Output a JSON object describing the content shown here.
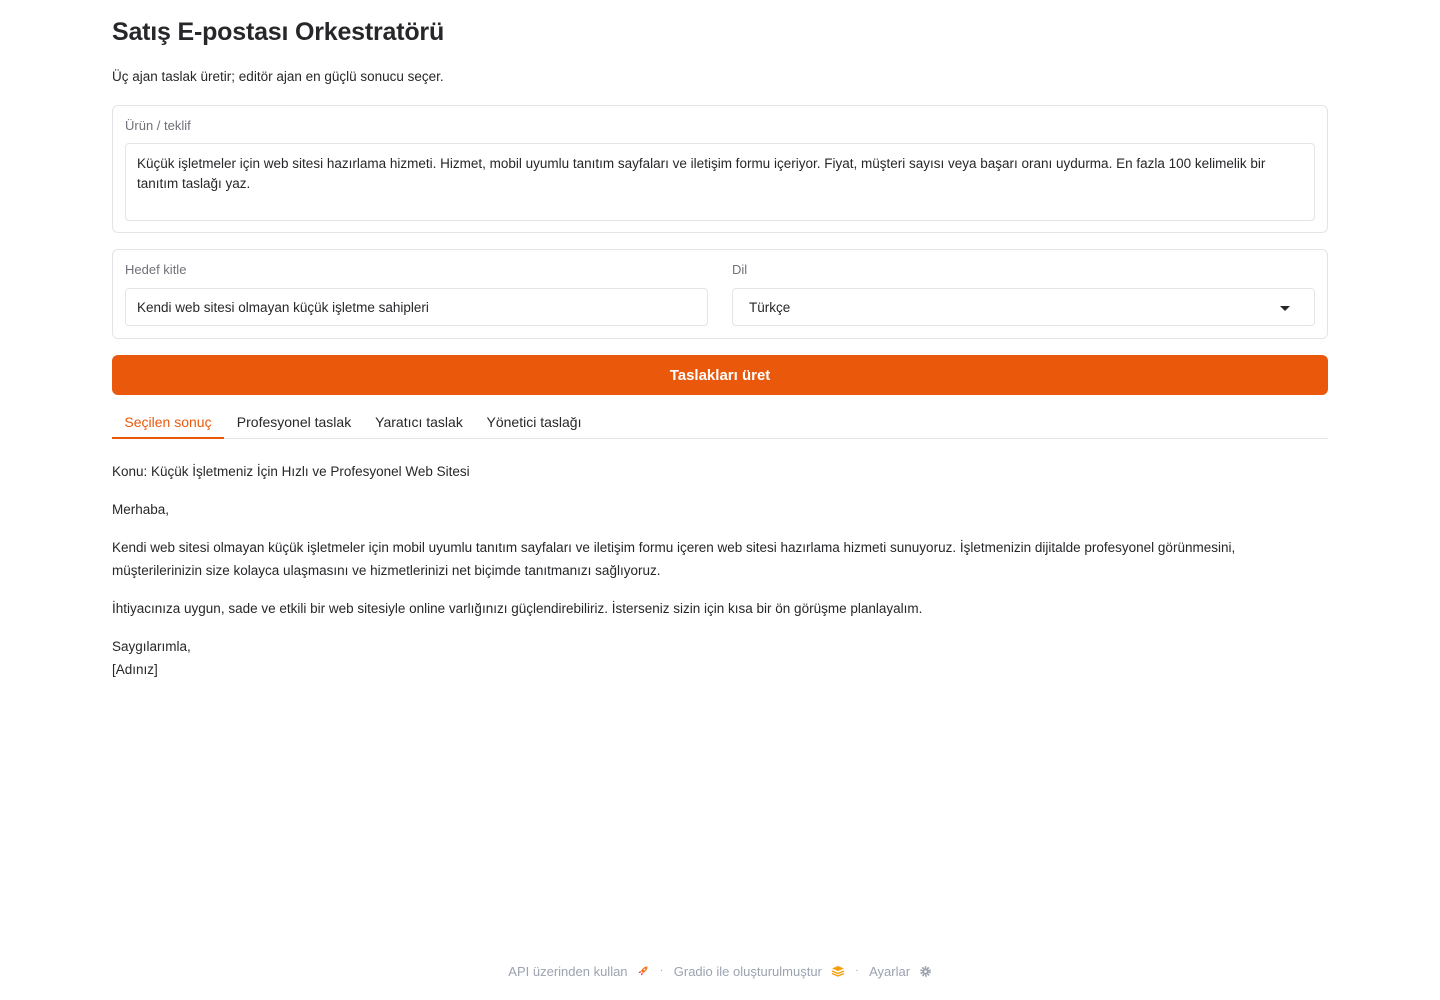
{
  "header": {
    "title": "Satış E-postası Orkestratörü",
    "subtitle": "Üç ajan taslak üretir; editör ajan en güçlü sonucu seçer."
  },
  "product": {
    "label": "Ürün / teklif",
    "value": "Küçük işletmeler için web sitesi hazırlama hizmeti. Hizmet, mobil uyumlu tanıtım sayfaları ve iletişim formu içeriyor. Fiyat, müşteri sayısı veya başarı oranı uydurma. En fazla 100 kelimelik bir tanıtım taslağı yaz."
  },
  "audience": {
    "label": "Hedef kitle",
    "value": "Kendi web sitesi olmayan küçük işletme sahipleri"
  },
  "language": {
    "label": "Dil",
    "selected": "Türkçe"
  },
  "generate_button": {
    "label": "Taslakları üret",
    "color": "#ea580c"
  },
  "tabs": [
    {
      "label": "Seçilen sonuç",
      "active": true
    },
    {
      "label": "Profesyonel taslak",
      "active": false
    },
    {
      "label": "Yaratıcı taslak",
      "active": false
    },
    {
      "label": "Yönetici taslağı",
      "active": false
    }
  ],
  "email": {
    "subject": "Konu: Küçük İşletmeniz İçin Hızlı ve Profesyonel Web Sitesi",
    "greeting": "Merhaba,",
    "paragraph1": "Kendi web sitesi olmayan küçük işletmeler için mobil uyumlu tanıtım sayfaları ve iletişim formu içeren web sitesi hazırlama hizmeti sunuyoruz. İşletmenizin dijitalde profesyonel görünmesini, müşterilerinizin size kolayca ulaşmasını ve hizmetlerinizi net biçimde tanıtmanızı sağlıyoruz.",
    "paragraph2": "İhtiyacınıza uygun, sade ve etkili bir web sitesiyle online varlığınızı güçlendirebiliriz. İsterseniz sizin için kısa bir ön görüşme planlayalım.",
    "closing": "Saygılarımla,",
    "signature": "[Adınız]"
  },
  "footer": {
    "api_link": "API üzerinden kullan",
    "built_with": "Gradio ile oluşturulmuştur",
    "settings": "Ayarlar",
    "separator": "·",
    "icons": [
      "rocket-icon",
      "gradio-logo-icon",
      "gear-icon"
    ]
  }
}
